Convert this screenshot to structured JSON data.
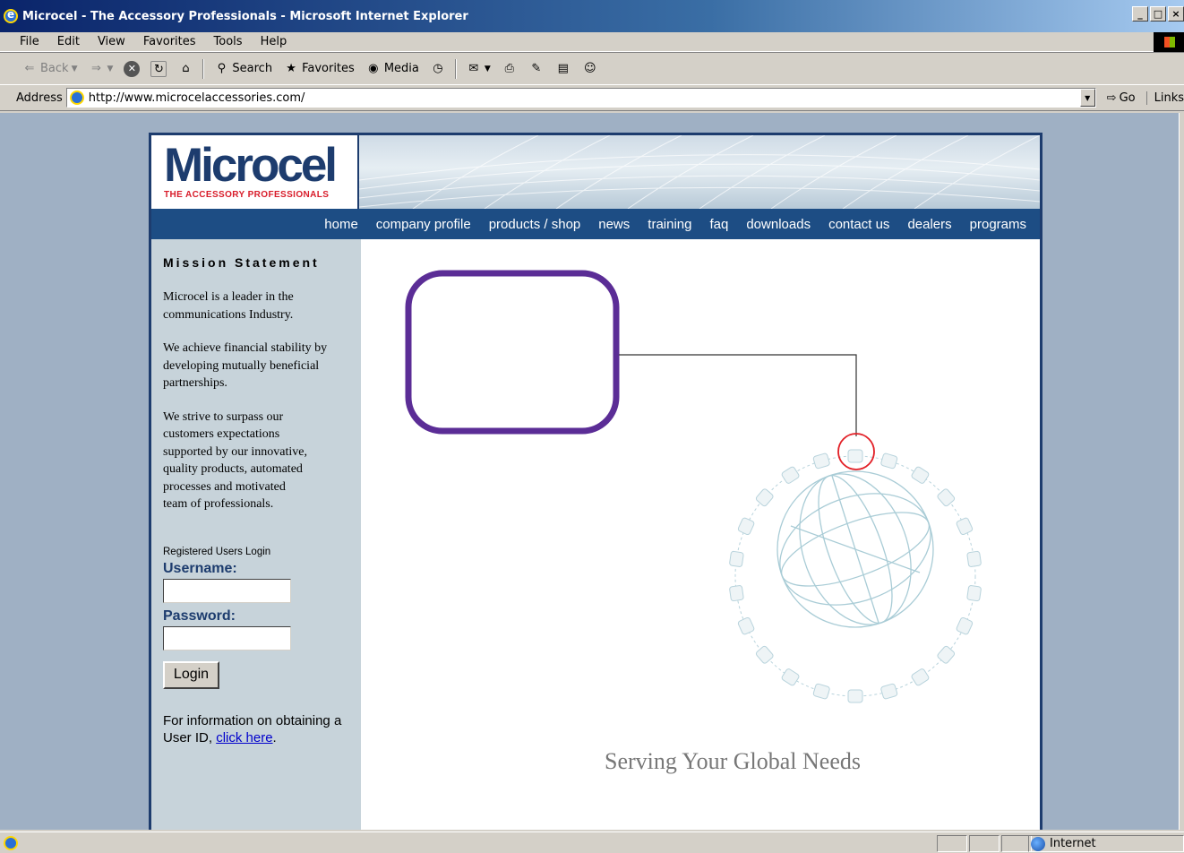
{
  "window": {
    "title": "Microcel - The Accessory Professionals - Microsoft Internet Explorer",
    "controls": [
      "_",
      "□",
      "×"
    ]
  },
  "menu": [
    "File",
    "Edit",
    "View",
    "Favorites",
    "Tools",
    "Help"
  ],
  "toolbar": {
    "back": "Back",
    "search": "Search",
    "favorites": "Favorites",
    "media": "Media"
  },
  "address": {
    "label": "Address",
    "url": "http://www.microcelaccessories.com/",
    "go": "Go",
    "links": "Links"
  },
  "site": {
    "logo_word": "Microcel",
    "logo_tagline": "THE ACCESSORY PROFESSIONALS",
    "nav": [
      "home",
      "company profile",
      "products / shop",
      "news",
      "training",
      "faq",
      "downloads",
      "contact us",
      "dealers",
      "programs"
    ],
    "mission_title": "Mission Statement",
    "mission": [
      "Microcel is a leader in the\ncommunications Industry.",
      "We achieve financial stability by\ndeveloping mutually beneficial\npartnerships.",
      "We strive to surpass our\ncustomers expectations\nsupported by our innovative,\nquality products, automated\nprocesses and motivated\nteam of professionals."
    ],
    "login": {
      "heading": "Registered Users Login",
      "username_label": "Username:",
      "password_label": "Password:",
      "button": "Login",
      "info_prefix": "For information on obtaining a User ID, ",
      "info_link": "click here",
      "info_suffix": "."
    },
    "tagline": "Serving Your Global Needs"
  },
  "status": {
    "zone": "Internet"
  },
  "colors": {
    "brand_navy": "#1d3c6e",
    "nav_bar": "#1d4d84",
    "accent_red": "#d81c2a",
    "purple_frame": "#5b2d96",
    "sidebar_bg": "#c7d3da",
    "page_bg": "#9fb0c4"
  }
}
